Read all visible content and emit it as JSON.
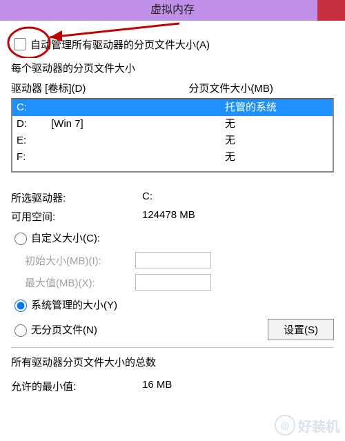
{
  "title": "虚拟内存",
  "auto_manage_label": "自动管理所有驱动器的分页文件大小(A)",
  "per_drive_label": "每个驱动器的分页文件大小",
  "columns": {
    "drive": "驱动器 [卷标](D)",
    "size": "分页文件大小(MB)"
  },
  "drives": [
    {
      "letter": "C:",
      "label": "",
      "size": "托管的系统",
      "selected": true
    },
    {
      "letter": "D:",
      "label": "[Win 7]",
      "size": "无",
      "selected": false
    },
    {
      "letter": "E:",
      "label": "",
      "size": "无",
      "selected": false
    },
    {
      "letter": "F:",
      "label": "",
      "size": "无",
      "selected": false
    }
  ],
  "selected_drive": {
    "k": "所选驱动器:",
    "v": "C:"
  },
  "free_space": {
    "k": "可用空间:",
    "v": "124478 MB"
  },
  "radio_custom": "自定义大小(C):",
  "initial_size": {
    "k": "初始大小(MB)(I):",
    "v": ""
  },
  "max_size": {
    "k": "最大值(MB)(X):",
    "v": ""
  },
  "radio_system": "系统管理的大小(Y)",
  "radio_none": "无分页文件(N)",
  "set_button": "设置(S)",
  "totals_label": "所有驱动器分页文件大小的总数",
  "min_allowed": {
    "k": "允许的最小值:",
    "v": "16 MB"
  },
  "watermark": "好装机"
}
